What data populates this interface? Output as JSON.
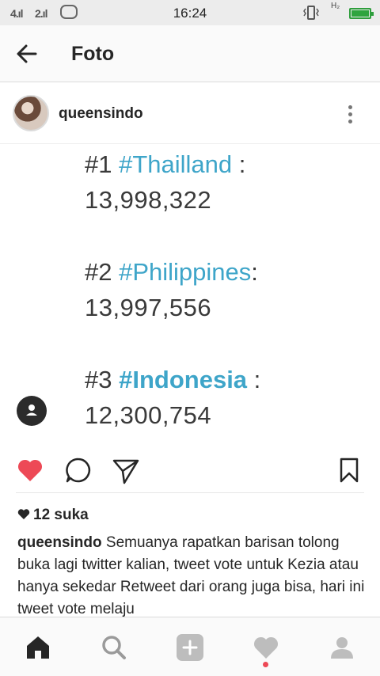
{
  "status_bar": {
    "signal_1": "4.ıl",
    "signal_2": "2.ıl",
    "time": "16:24",
    "network": "H₂",
    "icons": [
      "wechat-icon",
      "vibrate-icon",
      "battery-charging-icon"
    ]
  },
  "header": {
    "title": "Foto",
    "back_icon": "arrow-left-icon"
  },
  "post": {
    "username": "queensindo",
    "image": {
      "ranks": [
        {
          "rank": "#1",
          "tag": "#Thailland",
          "suffix": " :",
          "count": "13,998,322"
        },
        {
          "rank": "#2",
          "tag": "#Philippines",
          "suffix": ":",
          "count": "13,997,556"
        },
        {
          "rank": "#3",
          "tag": "#Indonesia",
          "suffix": " :",
          "count": "12,300,754"
        }
      ]
    },
    "likes_label": "12 suka",
    "caption_user": "queensindo",
    "caption_text": " Semuanya rapatkan barisan tolong buka lagi twitter kalian, tweet vote untuk Kezia atau hanya sekedar Retweet dari orang juga bisa,  hari ini tweet vote melaju"
  },
  "colors": {
    "like_red": "#ed4956",
    "hashtag_blue": "#3ea5c9",
    "text": "#262626"
  },
  "bottom_nav": [
    "home-icon",
    "search-icon",
    "add-post-icon",
    "activity-heart-icon",
    "profile-icon"
  ]
}
